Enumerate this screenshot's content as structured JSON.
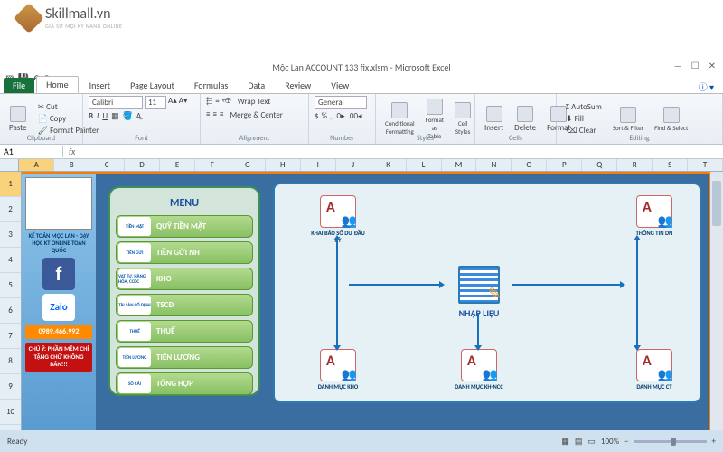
{
  "watermark": {
    "brand": "Skillmall.vn",
    "tagline": "GIA SƯ MỌI KỸ NĂNG ONLINE"
  },
  "window": {
    "title": "Mộc Lan ACCOUNT 133 fix.xlsm - Microsoft Excel",
    "min": "—",
    "max": "☐",
    "close": "✕"
  },
  "ribbon": {
    "tabs": [
      "File",
      "Home",
      "Insert",
      "Page Layout",
      "Formulas",
      "Data",
      "Review",
      "View"
    ],
    "active": "Home",
    "clipboard": {
      "label": "Clipboard",
      "paste": "Paste",
      "cut": "Cut",
      "copy": "Copy",
      "painter": "Format Painter"
    },
    "font": {
      "label": "Font",
      "family": "Calibri",
      "size": "11"
    },
    "alignment": {
      "label": "Alignment",
      "wrap": "Wrap Text",
      "merge": "Merge & Center"
    },
    "number": {
      "label": "Number",
      "format": "General"
    },
    "styles": {
      "label": "Styles",
      "cond": "Conditional\nFormatting",
      "table": "Format\nas Table",
      "cell": "Cell\nStyles"
    },
    "cells": {
      "label": "Cells",
      "insert": "Insert",
      "del": "Delete",
      "format": "Format"
    },
    "editing": {
      "label": "Editing",
      "sum": "AutoSum",
      "fill": "Fill",
      "clear": "Clear",
      "sort": "Sort &\nFilter",
      "find": "Find &\nSelect"
    }
  },
  "formula": {
    "namebox": "A1"
  },
  "cols": [
    "A",
    "B",
    "C",
    "D",
    "E",
    "F",
    "G",
    "H",
    "I",
    "J",
    "K",
    "L",
    "M",
    "N",
    "O",
    "P",
    "Q",
    "R",
    "S",
    "T"
  ],
  "rows": [
    "1",
    "2",
    "3",
    "4",
    "5",
    "6",
    "7",
    "8",
    "9",
    "10"
  ],
  "sidebar": {
    "promo": "KẾ TOÁN MỘC LAN - DẠY HỌC KT ONLINE TOÀN QUỐC",
    "fb": "f",
    "zalo": "Zalo",
    "phone": "0989.466.992",
    "warn": "CHÚ Ý: PHẦN MỀM CHỈ TẶNG CHỨ KHÔNG BÁN!!!"
  },
  "menu": {
    "title": "MENU",
    "items": [
      {
        "label": "QUỸ TIỀN MẶT",
        "icon": "TIỀN MẶT"
      },
      {
        "label": "TIỀN GỬI NH",
        "icon": "TIỀN GỬI"
      },
      {
        "label": "KHO",
        "icon": "VẬT TƯ, HÀNG HÓA, CCDC"
      },
      {
        "label": "TSCĐ",
        "icon": "TÀI SẢN CỐ ĐỊNH"
      },
      {
        "label": "THUẾ",
        "icon": "THUẾ"
      },
      {
        "label": "TIỀN LƯƠNG",
        "icon": "TIỀN LƯƠNG"
      },
      {
        "label": "TỔNG HỢP",
        "icon": "SỔ CÁI"
      }
    ]
  },
  "flow": {
    "center": "NHẬP LIỆU",
    "n1": "KHAI BÁO SỐ DƯ ĐẦU KỲ",
    "n2": "THÔNG TIN DN",
    "n3": "DANH MỤC KHO",
    "n4": "DANH MỤC KH-NCC",
    "n5": "DANH MỤC CT"
  },
  "status": {
    "ready": "Ready",
    "zoom": "100%"
  }
}
